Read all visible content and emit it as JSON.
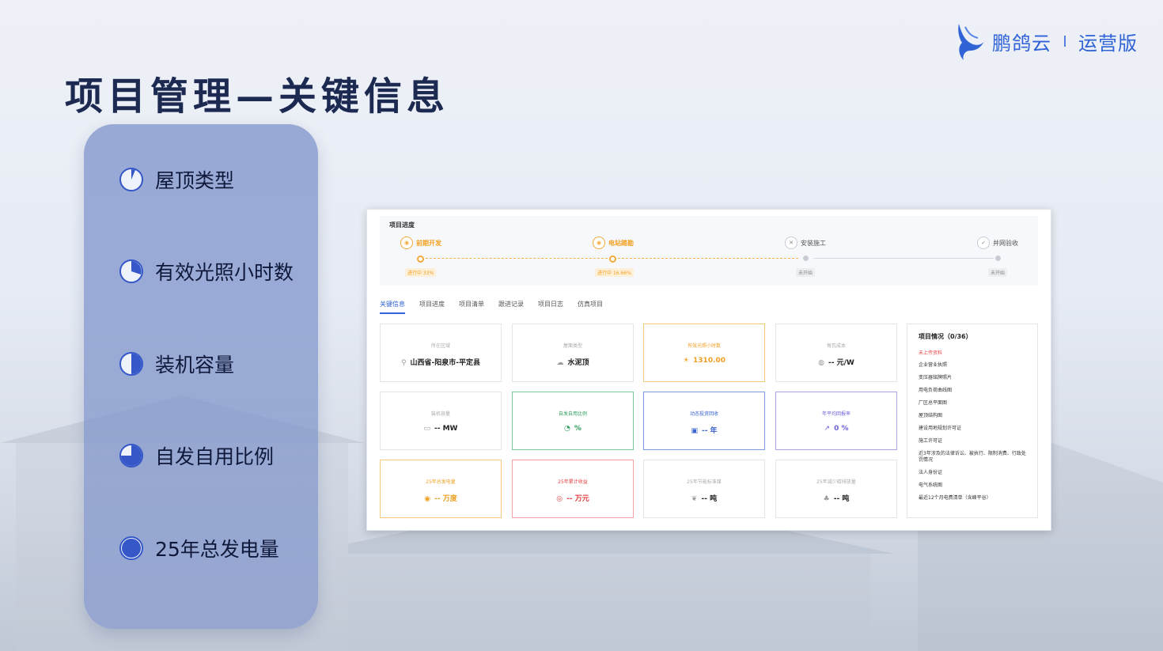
{
  "brand": {
    "name": "鹏鸽云",
    "edition": "运营版",
    "accent": "#2f63d6"
  },
  "page_title": "项目管理—关键信息",
  "sidebar": {
    "items": [
      {
        "label": "屋顶类型",
        "icon": "pie-quarter-icon",
        "fill": 0.12
      },
      {
        "label": "有效光照小时数",
        "icon": "pie-third-icon",
        "fill": 0.3
      },
      {
        "label": "装机容量",
        "icon": "pie-half-icon",
        "fill": 0.5
      },
      {
        "label": "自发自用比例",
        "icon": "pie-three-quarter-icon",
        "fill": 0.75
      },
      {
        "label": "25年总发电量",
        "icon": "pie-full-icon",
        "fill": 1.0
      }
    ]
  },
  "screen": {
    "progress": {
      "title": "项目进度",
      "stages": [
        {
          "name": "前期开发",
          "status": "进行中 33%",
          "active": true,
          "icon": "person-icon"
        },
        {
          "name": "电站踏勘",
          "status": "进行中 16.66%",
          "active": true,
          "icon": "survey-icon"
        },
        {
          "name": "安装施工",
          "status": "未开始",
          "active": false,
          "icon": "tools-icon"
        },
        {
          "name": "并网验收",
          "status": "未开始",
          "active": false,
          "icon": "check-doc-icon"
        }
      ]
    },
    "tabs": [
      "关键信息",
      "项目进度",
      "项目清单",
      "跟进记录",
      "项目日志",
      "仿真项目"
    ],
    "cards": [
      {
        "title": "所在区域",
        "value": "山西省-阳泉市-平定县",
        "icon": "location-icon",
        "tone": "default"
      },
      {
        "title": "屋面类型",
        "value": "水泥顶",
        "icon": "cloud-icon",
        "tone": "default"
      },
      {
        "title": "有效光照小时数",
        "value": "1310.00",
        "icon": "sun-icon",
        "tone": "orange"
      },
      {
        "title": "每瓦成本",
        "value": "-- 元/W",
        "icon": "coin-icon",
        "tone": "default"
      },
      {
        "title": "装机容量",
        "value": "-- MW",
        "icon": "battery-icon",
        "tone": "default"
      },
      {
        "title": "自发自用比例",
        "value": "%",
        "icon": "pie-chart-icon",
        "tone": "green"
      },
      {
        "title": "动态投资回收",
        "value": "-- 年",
        "icon": "calculator-icon",
        "tone": "blue"
      },
      {
        "title": "年平均回报率",
        "value": "0 %",
        "icon": "chart-up-icon",
        "tone": "purple"
      },
      {
        "title": "25年总发电量",
        "value": "-- 万度",
        "icon": "bolt-icon",
        "tone": "orange"
      },
      {
        "title": "25年累计收益",
        "value": "-- 万元",
        "icon": "money-icon",
        "tone": "red"
      },
      {
        "title": "25年节能标准煤",
        "value": "-- 吨",
        "icon": "leaf-icon",
        "tone": "default"
      },
      {
        "title": "25年减少碳排放量",
        "value": "-- 吨",
        "icon": "tree-icon",
        "tone": "default"
      }
    ],
    "docs": {
      "title": "项目情况（0/36）",
      "missing_label": "未上传资料",
      "items": [
        "企业营业执照",
        "变压器铭牌照片",
        "用电负荷曲线图",
        "厂区总平面图",
        "屋顶结构图",
        "建设用地规划许可证",
        "施工许可证",
        "近3年涉及的法律诉讼、被执行、限制消费、行政处罚情况",
        "法人身份证",
        "电气系统图",
        "最近12个月电费清单（含峰平谷）"
      ]
    }
  }
}
